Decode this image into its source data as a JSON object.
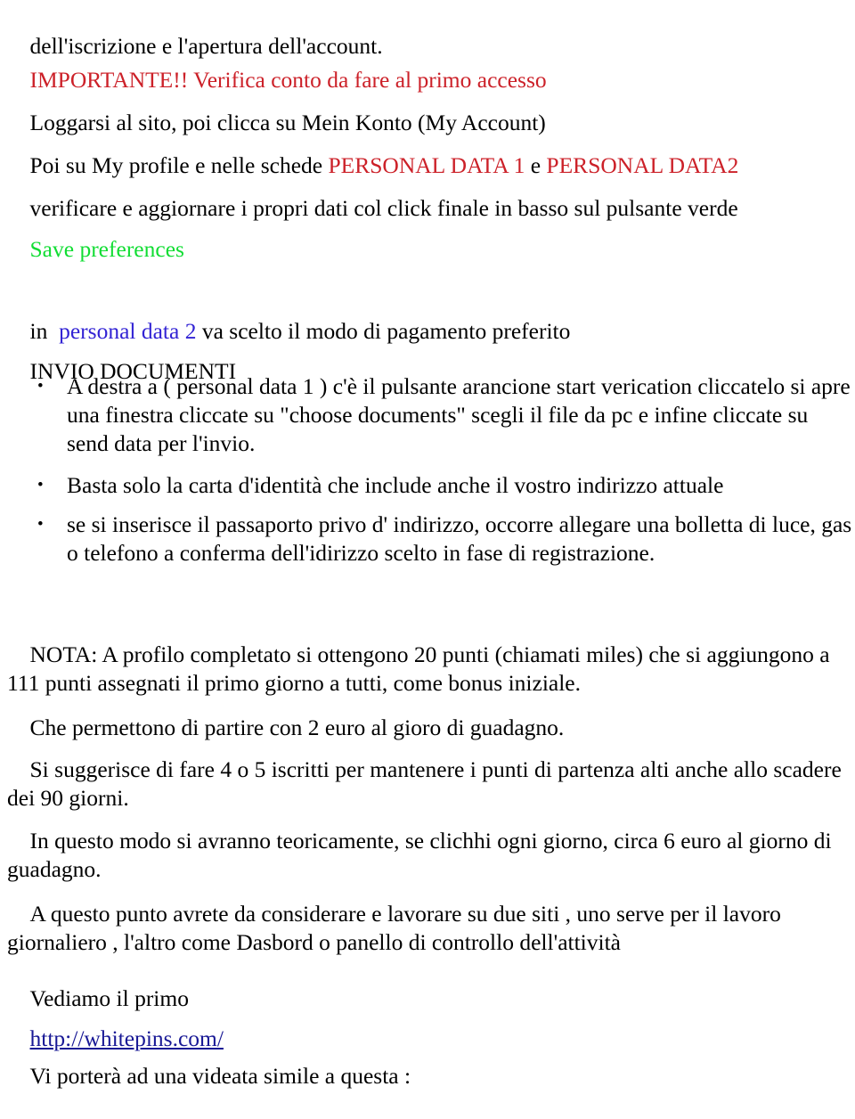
{
  "document": {
    "language": "it",
    "colors": {
      "red": "#CC2129",
      "green": "#11DD33",
      "blue": "#3223D4",
      "link_navy": "#181895",
      "body_text": "#000000",
      "background": "#FFFFFF"
    },
    "lines": {
      "l1": "dell'iscrizione e l'apertura dell'account.",
      "l2_red": "IMPORTANTE!! Verifica conto da fare al primo accesso",
      "l3": "Loggarsi al sito, poi clicca su Mein Konto (My Account)",
      "l4_a": "Poi su My profile e nelle schede ",
      "l4_red1": "PERSONAL DATA 1",
      "l4_b": " e ",
      "l4_red2": "PERSONAL DATA2",
      "l5": "verificare e aggiornare i propri dati col click finale in basso sul pulsante verde",
      "l6_green": "Save preferences",
      "l7_a": "in ",
      "l7_blue": " personal data 2 ",
      "l7_b": "va scelto il modo di pagamento preferito",
      "l8_heading": "INVIO DOCUMENTI",
      "bullet1": "A destra a ( personal data 1 ) c'è il pulsante arancione start verication cliccatelo si apre una finestra cliccate su \"choose documents\" scegli il file da pc e infine cliccate su send data per l'invio.",
      "bullet2": "Basta solo la carta d'identità che include anche il vostro indirizzo attuale",
      "bullet3": "se si inserisce il passaporto privo d' indirizzo, occorre allegare una bolletta di luce, gas o telefono a conferma dell'idirizzo scelto in fase di registrazione.",
      "l9": "NOTA: A profilo completato si ottengono 20 punti (chiamati miles) che si aggiungono a 111 punti assegnati il primo giorno a tutti, come bonus iniziale.",
      "l10": "Che permettono di partire con 2 euro al gioro di guadagno.",
      "l11": "Si suggerisce di fare 4 o 5 iscritti per mantenere i punti di partenza alti anche allo scadere dei 90 giorni.",
      "l12": "In questo modo si avranno teoricamente, se clichhi ogni giorno, circa 6 euro al giorno di guadagno.",
      "l13": "A questo punto avrete da considerare e lavorare su due siti , uno serve per il lavoro giornaliero , l'altro come Dasbord o panello di controllo dell'attività",
      "l14": "Vediamo il primo",
      "l15_link": "http://whitepins.com/",
      "l16": "Vi porterà ad una videata simile a questa :"
    },
    "bullet_marker": "•",
    "numbers_mentioned": {
      "punti_profilo": 20,
      "punti_bonus_iniziale": 111,
      "euro_al_giorno_iniziali": 2,
      "iscritti_suggeriti": "4 o 5",
      "giorni_scadenza": 90,
      "euro_al_giorno_stimati": 6
    }
  }
}
